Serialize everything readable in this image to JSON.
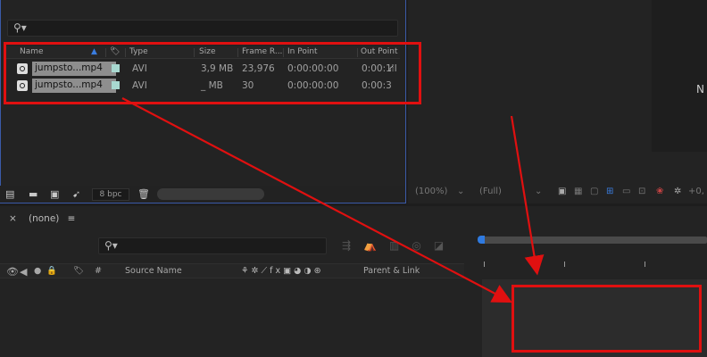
{
  "project": {
    "columns": [
      "Name",
      "Type",
      "Size",
      "Frame R...",
      "In Point",
      "Out Point"
    ],
    "rows": [
      {
        "name": "jumpsto...mp4",
        "type": "AVI",
        "size": "3,9 MB",
        "frame_rate": "23,976",
        "in_point": "0:00:00:00",
        "out_point": "0:00:1"
      },
      {
        "name": "jumpsto...mp4",
        "type": "AVI",
        "size": "_ MB",
        "frame_rate": "30",
        "in_point": "0:00:00:00",
        "out_point": "0:00:3"
      }
    ],
    "bpc": "8 bpc"
  },
  "viewer": {
    "resolution": "(100%)",
    "quality": "(Full)",
    "side_text": "N",
    "exposure": "+0,"
  },
  "timeline": {
    "tab_label": "(none)",
    "columns": [
      "#",
      "Source Name",
      "Parent & Link"
    ]
  },
  "colors": {
    "annotation": "#e01010",
    "label_swatch": "#a8d8d0",
    "accent": "#2f7ae0"
  }
}
